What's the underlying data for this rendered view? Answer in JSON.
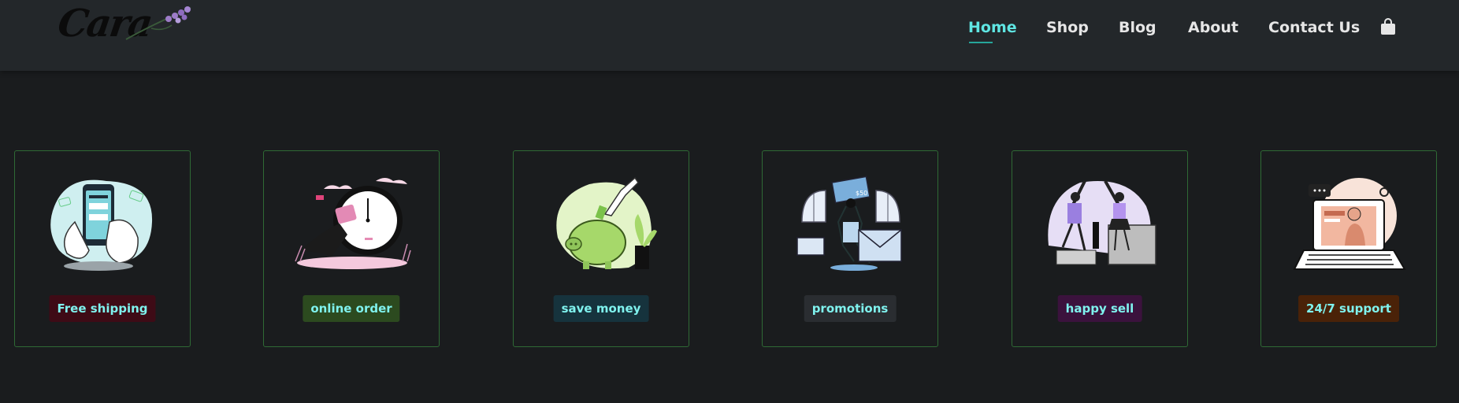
{
  "brand": {
    "name": "Cara"
  },
  "nav": {
    "items": [
      {
        "label": "Home",
        "active": true
      },
      {
        "label": "Shop",
        "active": false
      },
      {
        "label": "Blog",
        "active": false
      },
      {
        "label": "About",
        "active": false
      },
      {
        "label": "Contact Us",
        "active": false
      }
    ],
    "cart_icon": "shopping-bag-icon",
    "active_color": "#5fe6e3"
  },
  "features": [
    {
      "label": "Free shipping",
      "badge_color": "#3e0b16",
      "icon": "mobile-payment-illustration"
    },
    {
      "label": "online order",
      "badge_color": "#2c4a1f",
      "icon": "clock-runner-illustration"
    },
    {
      "label": "save money",
      "badge_color": "#16333d",
      "icon": "piggy-bank-illustration"
    },
    {
      "label": "promotions",
      "badge_color": "#2a2d31",
      "icon": "gift-box-illustration"
    },
    {
      "label": "happy sell",
      "badge_color": "#3b123d",
      "icon": "high-five-illustration"
    },
    {
      "label": "24/7 support",
      "badge_color": "#4a2208",
      "icon": "laptop-support-illustration"
    }
  ],
  "colors": {
    "background": "#1a1c1e",
    "header": "#23272a",
    "card_border": "#2f6a35",
    "badge_text": "#7ff2ee"
  }
}
